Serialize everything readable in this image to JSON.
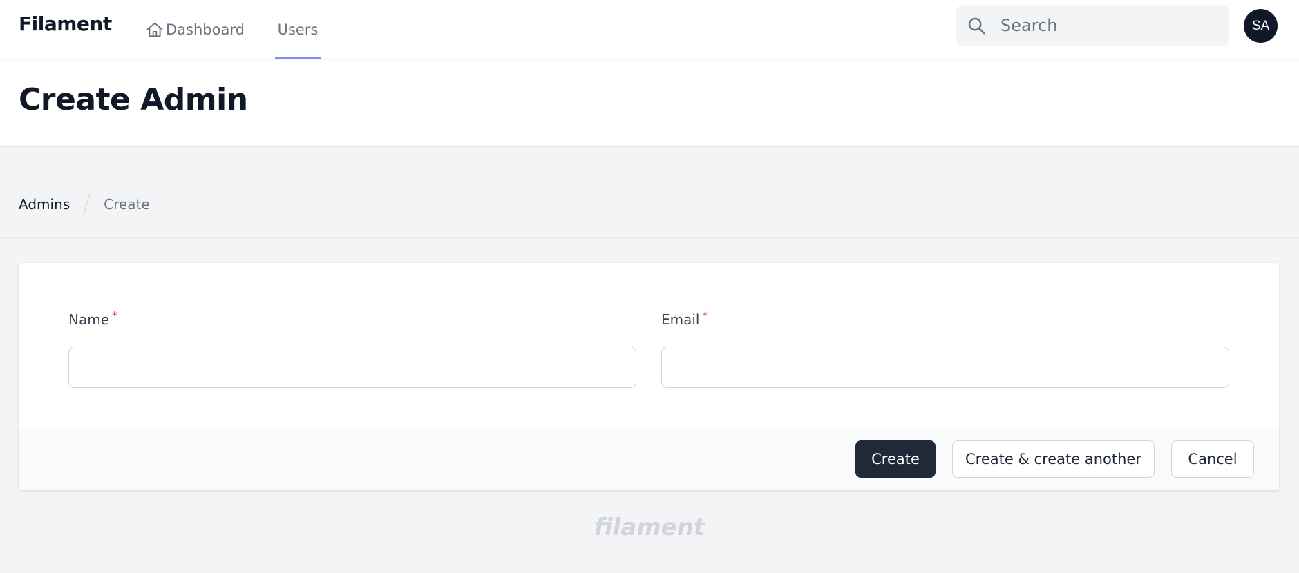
{
  "app": {
    "brand": "Filament",
    "footer_logo": "filament"
  },
  "nav": {
    "items": [
      {
        "label": "Dashboard",
        "icon": "home-icon",
        "active": false
      },
      {
        "label": "Users",
        "active": true
      }
    ]
  },
  "search": {
    "placeholder": "Search",
    "value": "",
    "icon": "search-icon"
  },
  "user": {
    "initials": "SA"
  },
  "page": {
    "title": "Create Admin"
  },
  "breadcrumb": {
    "items": [
      "Admins",
      "Create"
    ]
  },
  "form": {
    "fields": [
      {
        "label": "Name",
        "required_mark": "*",
        "value": ""
      },
      {
        "label": "Email",
        "required_mark": "*",
        "value": ""
      }
    ],
    "actions": {
      "create": "Create",
      "create_another": "Create & create another",
      "cancel": "Cancel"
    }
  },
  "colors": {
    "accent": "#818cf8",
    "primary_button": "#1f2937",
    "required": "#dc2626",
    "background": "#f3f4f6"
  }
}
